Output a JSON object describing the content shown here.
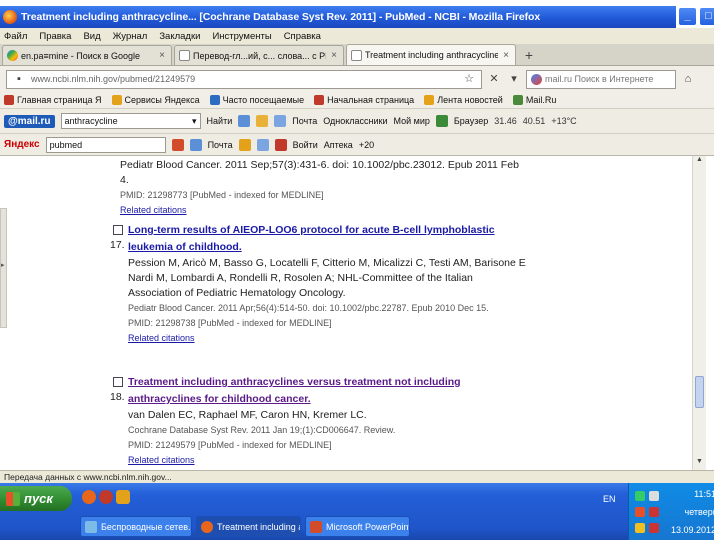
{
  "window": {
    "title": "Treatment including anthracycline... [Cochrane Database Syst Rev. 2011] - PubMed - NCBI - Mozilla Firefox",
    "controls": [
      "_",
      "□",
      "✕"
    ]
  },
  "menu": [
    "Файл",
    "Правка",
    "Вид",
    "Журнал",
    "Закладки",
    "Инструменты",
    "Справка"
  ],
  "tabs": [
    {
      "label": "en.pa≡mine - Поиск в Google",
      "icon": "google-icon",
      "active": false
    },
    {
      "label": "Перевод-гл...ий, с... слова... с PRO...",
      "icon": "page-icon",
      "active": false
    },
    {
      "label": "Treatment including anthracycline... [Co...",
      "icon": "page-icon",
      "active": true
    }
  ],
  "nav": {
    "url": "www.ncbi.nlm.nih.gov/pubmed/21249579",
    "search_placeholder": "mail.ru  Поиск в Интернете"
  },
  "bookmarks": [
    "Главная страница Я",
    "Сервисы Яндекса",
    "Часто посещаемые",
    "Начальная страница",
    "Лента новостей",
    "Mail.Ru"
  ],
  "mailbar": {
    "logo": "@mail.ru",
    "query": "anthracycline",
    "find_label": "Найти",
    "items": [
      "Почта",
      "Одноклассники",
      "Мой мир",
      "Браузер"
    ],
    "weather": [
      "31.46",
      "40.51",
      "+13°C"
    ]
  },
  "yabar": {
    "logo": "Яндекс",
    "query": "pubmed",
    "items": [
      "Почта",
      "Войти",
      "Аптека",
      "+20"
    ]
  },
  "results": [
    {
      "lines": [
        "Pediatr Blood Cancer. 2011 Sep;57(3):431-6. doi: 10.1002/pbc.23012. Epub 2011 Feb 4."
      ],
      "meta": "PMID: 21298773 [PubMed - indexed for MEDLINE]",
      "related": "Related citations"
    },
    {
      "num": "17.",
      "title_1": "Long-term results of AIEOP-LOO6 protocol for acute B-cell lymphoblastic",
      "title_2": "leukemia of childhood.",
      "lines": [
        "Pession M, Aricò M, Basso G, Locatelli F, Citterio M, Micalizzi C, Testi AM, Barisone E",
        "Nardi M, Lombardi A, Rondelli R, Rosolen A; NHL-Committee of the Italian",
        "Association of Pediatric Hematology Oncology.",
        "Pediatr Blood Cancer. 2011 Apr;56(4):514-50. doi: 10.1002/pbc.22787. Epub 2010 Dec 15."
      ],
      "meta": "PMID: 21298738 [PubMed - indexed for MEDLINE]",
      "related": "Related citations"
    },
    {
      "num": "18.",
      "title_1": "Treatment including anthracyclines versus treatment not including",
      "title_2": "anthracyclines for childhood cancer.",
      "lines": [
        "van Dalen EC, Raphael MF, Caron HN, Kremer LC.",
        "Cochrane Database Syst Rev. 2011 Jan 19;(1):CD006647. Review."
      ],
      "meta": "PMID: 21249579 [PubMed - indexed for MEDLINE]",
      "related": "Related citations"
    }
  ],
  "status": "Передача данных с www.ncbi.nlm.nih.gov...",
  "taskbar": {
    "start": "пуск",
    "buttons": [
      "Беспроводные сетев...",
      "Treatment including a...",
      "Microsoft PowerPoint..."
    ],
    "lang": "EN",
    "time": "11:51",
    "day": "четверг",
    "date": "13.09.2012"
  }
}
